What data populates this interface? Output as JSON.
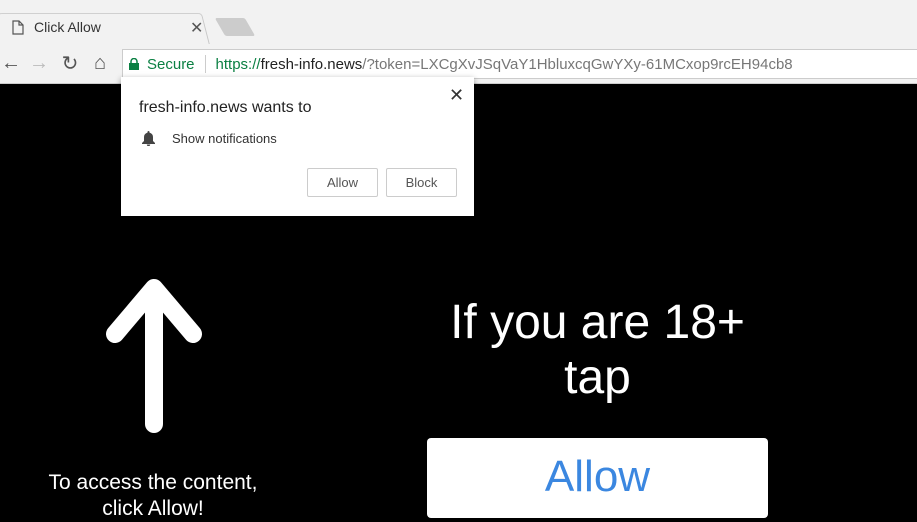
{
  "browser": {
    "tab": {
      "title": "Click Allow",
      "icon": "page-icon",
      "close_icon": "close-icon"
    },
    "new_tab_icon": "new-tab-icon",
    "nav": {
      "back_icon": "←",
      "forward_icon": "→",
      "reload_icon": "↻",
      "home_icon": "⌂"
    },
    "omnibox": {
      "secure_label": "Secure",
      "url_scheme": "https://",
      "url_host": "fresh-info.news",
      "url_path": "/?token=LXCgXvJSqVaY1HbluxcqGwYXy-61MCxop9rcEH94cb8"
    }
  },
  "permission_popup": {
    "title": "fresh-info.news wants to",
    "permission": "Show notifications",
    "allow_label": "Allow",
    "block_label": "Block",
    "close_glyph": "✕"
  },
  "page": {
    "left_text_line1": "To access the content,",
    "left_text_line2": "click Allow!",
    "headline_line1": "If you are 18+",
    "headline_line2": "tap",
    "allow_button_label": "Allow"
  },
  "colors": {
    "secure_green": "#0b8043",
    "allow_blue": "#3b87e0",
    "background": "#000000"
  }
}
